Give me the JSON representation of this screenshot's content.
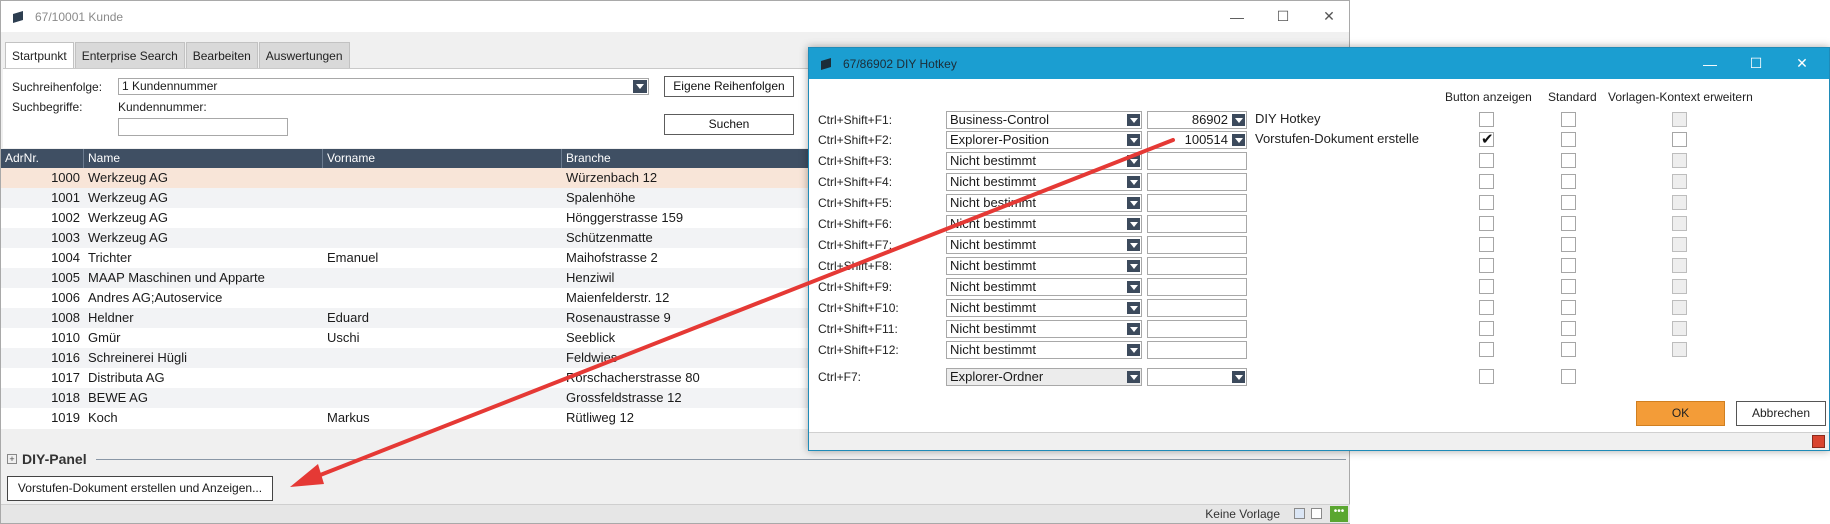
{
  "main": {
    "title": "67/10001 Kunde",
    "tabs": [
      "Startpunkt",
      "Enterprise Search",
      "Bearbeiten",
      "Auswertungen"
    ],
    "search": {
      "order_label": "Suchreihenfolge:",
      "order_value": "1 Kundennummer",
      "own_order_button": "Eigene Reihenfolgen",
      "terms_label": "Suchbegriffe:",
      "customer_no_label": "Kundennummer:",
      "customer_no_value": "",
      "search_button": "Suchen"
    },
    "grid": {
      "columns": [
        "AdrNr.",
        "Name",
        "Vorname",
        "Branche"
      ],
      "rows": [
        {
          "nr": "1000",
          "name": "Werkzeug AG",
          "vorname": "",
          "branche": "Würzenbach 12"
        },
        {
          "nr": "1001",
          "name": "Werkzeug AG",
          "vorname": "",
          "branche": "Spalenhöhe"
        },
        {
          "nr": "1002",
          "name": "Werkzeug AG",
          "vorname": "",
          "branche": "Hönggerstrasse 159"
        },
        {
          "nr": "1003",
          "name": "Werkzeug AG",
          "vorname": "",
          "branche": "Schützenmatte"
        },
        {
          "nr": "1004",
          "name": "Trichter",
          "vorname": "Emanuel",
          "branche": "Maihofstrasse 2"
        },
        {
          "nr": "1005",
          "name": "MAAP Maschinen und Apparte",
          "vorname": "",
          "branche": "Henziwil"
        },
        {
          "nr": "1006",
          "name": "Andres AG;Autoservice",
          "vorname": "",
          "branche": "Maienfelderstr. 12"
        },
        {
          "nr": "1008",
          "name": "Heldner",
          "vorname": "Eduard",
          "branche": "Rosenaustrasse 9"
        },
        {
          "nr": "1010",
          "name": "Gmür",
          "vorname": "Uschi",
          "branche": "Seeblick"
        },
        {
          "nr": "1016",
          "name": "Schreinerei Hügli",
          "vorname": "",
          "branche": "Feldwies"
        },
        {
          "nr": "1017",
          "name": "Distributa AG",
          "vorname": "",
          "branche": "Rorschacherstrasse 80"
        },
        {
          "nr": "1018",
          "name": "BEWE AG",
          "vorname": "",
          "branche": "Grossfeldstrasse 12"
        },
        {
          "nr": "1019",
          "name": "Koch",
          "vorname": "Markus",
          "branche": "Rütliweg 12"
        }
      ]
    },
    "diy_panel": {
      "title": "DIY-Panel",
      "expander": "+",
      "action_button": "Vorstufen-Dokument erstellen und Anzeigen..."
    },
    "status": {
      "text": "Keine Vorlage",
      "indicator": "•••"
    }
  },
  "dialog": {
    "title": "67/86902 DIY Hotkey",
    "column_headers": {
      "button_show": "Button anzeigen",
      "standard": "Standard",
      "template_context": "Vorlagen-Kontext erweitern"
    },
    "rows": [
      {
        "key": "Ctrl+Shift+F1:",
        "type": "Business-Control",
        "value": "86902",
        "desc": "DIY Hotkey",
        "button_show": false,
        "standard": false
      },
      {
        "key": "Ctrl+Shift+F2:",
        "type": "Explorer-Position",
        "value": "100514",
        "desc": "Vorstufen-Dokument erstelle",
        "button_show": true,
        "standard": false
      },
      {
        "key": "Ctrl+Shift+F3:",
        "type": "Nicht bestimmt",
        "value": "",
        "desc": "",
        "button_show": false,
        "standard": false
      },
      {
        "key": "Ctrl+Shift+F4:",
        "type": "Nicht bestimmt",
        "value": "",
        "desc": "",
        "button_show": false,
        "standard": false
      },
      {
        "key": "Ctrl+Shift+F5:",
        "type": "Nicht bestimmt",
        "value": "",
        "desc": "",
        "button_show": false,
        "standard": false
      },
      {
        "key": "Ctrl+Shift+F6:",
        "type": "Nicht bestimmt",
        "value": "",
        "desc": "",
        "button_show": false,
        "standard": false
      },
      {
        "key": "Ctrl+Shift+F7:",
        "type": "Nicht bestimmt",
        "value": "",
        "desc": "",
        "button_show": false,
        "standard": false
      },
      {
        "key": "Ctrl+Shift+F8:",
        "type": "Nicht bestimmt",
        "value": "",
        "desc": "",
        "button_show": false,
        "standard": false
      },
      {
        "key": "Ctrl+Shift+F9:",
        "type": "Nicht bestimmt",
        "value": "",
        "desc": "",
        "button_show": false,
        "standard": false
      },
      {
        "key": "Ctrl+Shift+F10:",
        "type": "Nicht bestimmt",
        "value": "",
        "desc": "",
        "button_show": false,
        "standard": false
      },
      {
        "key": "Ctrl+Shift+F11:",
        "type": "Nicht bestimmt",
        "value": "",
        "desc": "",
        "button_show": false,
        "standard": false
      },
      {
        "key": "Ctrl+Shift+F12:",
        "type": "Nicht bestimmt",
        "value": "",
        "desc": "",
        "button_show": false,
        "standard": false
      }
    ],
    "extra_row": {
      "key": "Ctrl+F7:",
      "type": "Explorer-Ordner",
      "value": "",
      "desc": "",
      "button_show": false,
      "standard": false
    },
    "ok_button": "OK",
    "cancel_button": "Abbrechen"
  },
  "colors": {
    "accent_blue": "#1b9ed1",
    "grid_header": "#3f4f63",
    "ok_orange": "#f39c38",
    "annotation_arrow": "#e53935",
    "selected_row": "#f8e5d8"
  },
  "icons": {
    "app": "app-logo-icon",
    "minimize": "minimize-icon",
    "maximize": "maximize-icon",
    "close": "close-icon",
    "dropdown": "chevron-down-icon",
    "checkmark": "check-icon"
  }
}
